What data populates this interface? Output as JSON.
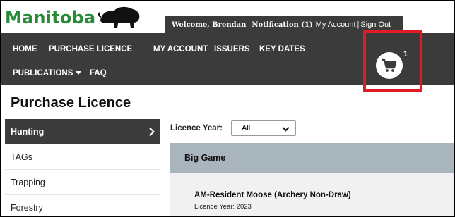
{
  "header": {
    "logo_text": "Manitoba",
    "welcome": "Welcome, Brendan",
    "notification": "Notification (1)",
    "my_account_link": "My Account",
    "separator": "|",
    "sign_out_link": "Sign Out"
  },
  "nav": {
    "items": [
      {
        "label": "HOME"
      },
      {
        "label": "PURCHASE LICENCE"
      },
      {
        "label": "MY ACCOUNT"
      },
      {
        "label": "ISSUERS"
      },
      {
        "label": "KEY DATES"
      },
      {
        "label": "PUBLICATIONS"
      },
      {
        "label": "FAQ"
      }
    ],
    "cart_count": "1"
  },
  "page_title": "Purchase Licence",
  "sidebar": {
    "items": [
      {
        "label": "Hunting",
        "active": true
      },
      {
        "label": "TAGs"
      },
      {
        "label": "Trapping"
      },
      {
        "label": "Forestry"
      }
    ]
  },
  "filters": {
    "licence_year_label": "Licence Year:",
    "licence_year_value": "All"
  },
  "category": {
    "title": "Big Game"
  },
  "licences": [
    {
      "name": "AM-Resident Moose (Archery Non-Draw)",
      "year": "Licence Year: 2023"
    }
  ],
  "colors": {
    "nav_bg": "#3b3b3b",
    "logo_green": "#2a8a3a",
    "highlight_red": "#e01b24",
    "category_bg": "#a9b5bc"
  }
}
